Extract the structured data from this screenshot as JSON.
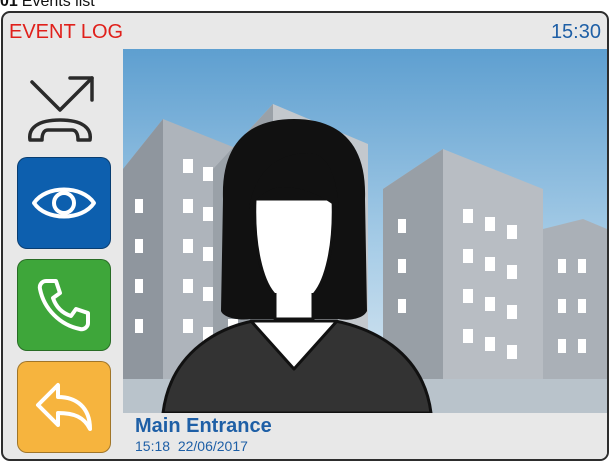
{
  "caption": {
    "number": "01",
    "text": "Events list"
  },
  "header": {
    "title": "EVENT LOG",
    "time": "15:30"
  },
  "sidebar": {
    "buttons": [
      {
        "icon": "call-redirect-icon",
        "color": "#e8e8e8"
      },
      {
        "icon": "eye-icon",
        "color": "#0d5fae"
      },
      {
        "icon": "phone-icon",
        "color": "#3ea63a"
      },
      {
        "icon": "back-arrow-icon",
        "color": "#f6b43e"
      }
    ]
  },
  "event": {
    "location": "Main Entrance",
    "time": "15:18",
    "date": "22/06/2017"
  },
  "colors": {
    "title_red": "#e0201b",
    "accent_blue": "#1e5fa6",
    "sky": "#9cc6e4",
    "building": "#b3b8bf"
  }
}
